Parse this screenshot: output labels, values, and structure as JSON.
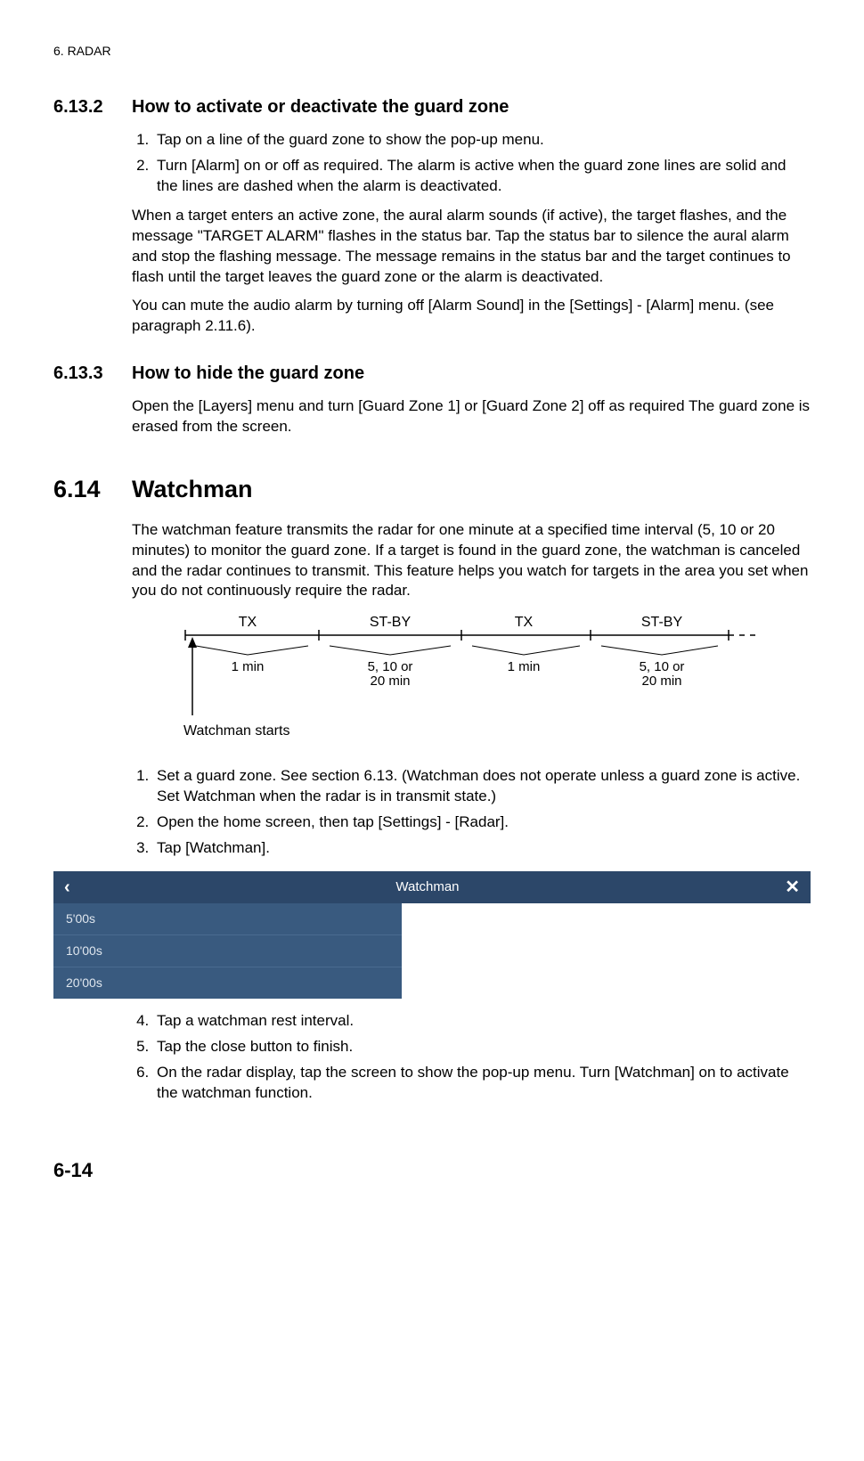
{
  "header": {
    "running": "6.  RADAR"
  },
  "s6_13_2": {
    "num": "6.13.2",
    "title": "How to activate or deactivate the guard zone",
    "steps": [
      "Tap on a line of the guard zone to show the pop-up menu.",
      "Turn [Alarm] on or off as required. The alarm is active when the guard zone lines are solid and the lines are dashed when the alarm is deactivated."
    ],
    "p1": "When a target enters an active zone, the aural alarm sounds (if active), the target flashes, and the message \"TARGET ALARM\" flashes in the status bar. Tap the status bar to silence the aural alarm and stop the flashing message. The message remains in the status bar and the target continues to flash until the target leaves the guard zone or the alarm is deactivated.",
    "p2": "You can mute the audio alarm by turning off [Alarm Sound] in the [Settings] - [Alarm] menu. (see paragraph 2.11.6)."
  },
  "s6_13_3": {
    "num": "6.13.3",
    "title": "How to hide the guard zone",
    "p1": "Open the [Layers] menu and turn [Guard Zone 1] or [Guard Zone 2] off as required The guard zone is erased from the screen."
  },
  "s6_14": {
    "num": "6.14",
    "title": "Watchman",
    "p1": "The watchman feature transmits the radar for one minute at a specified time interval (5, 10 or 20 minutes) to monitor the guard zone. If a target is found in the guard zone, the watchman is canceled and the radar continues to transmit. This feature helps you watch for targets in the area you set when you do not continuously require the radar.",
    "diagram": {
      "seg": [
        "TX",
        "ST-BY",
        "TX",
        "ST-BY"
      ],
      "under": [
        "1 min",
        "5, 10 or\n20 min",
        "1 min",
        "5, 10 or\n20 min"
      ],
      "caption": "Watchman starts"
    },
    "steps_a": [
      "Set a guard zone. See section 6.13. (Watchman does not operate unless a guard zone is active. Set Watchman when the radar is in transmit state.)",
      "Open the home screen, then tap [Settings] - [Radar].",
      "Tap [Watchman]."
    ],
    "ui": {
      "title": "Watchman",
      "options": [
        "5'00s",
        "10'00s",
        "20'00s"
      ]
    },
    "steps_b": [
      "Tap a watchman rest interval.",
      "Tap the close button to finish.",
      "On the radar display, tap the screen to show the pop-up menu. Turn [Watchman] on to activate the watchman function."
    ]
  },
  "page_num": "6-14"
}
